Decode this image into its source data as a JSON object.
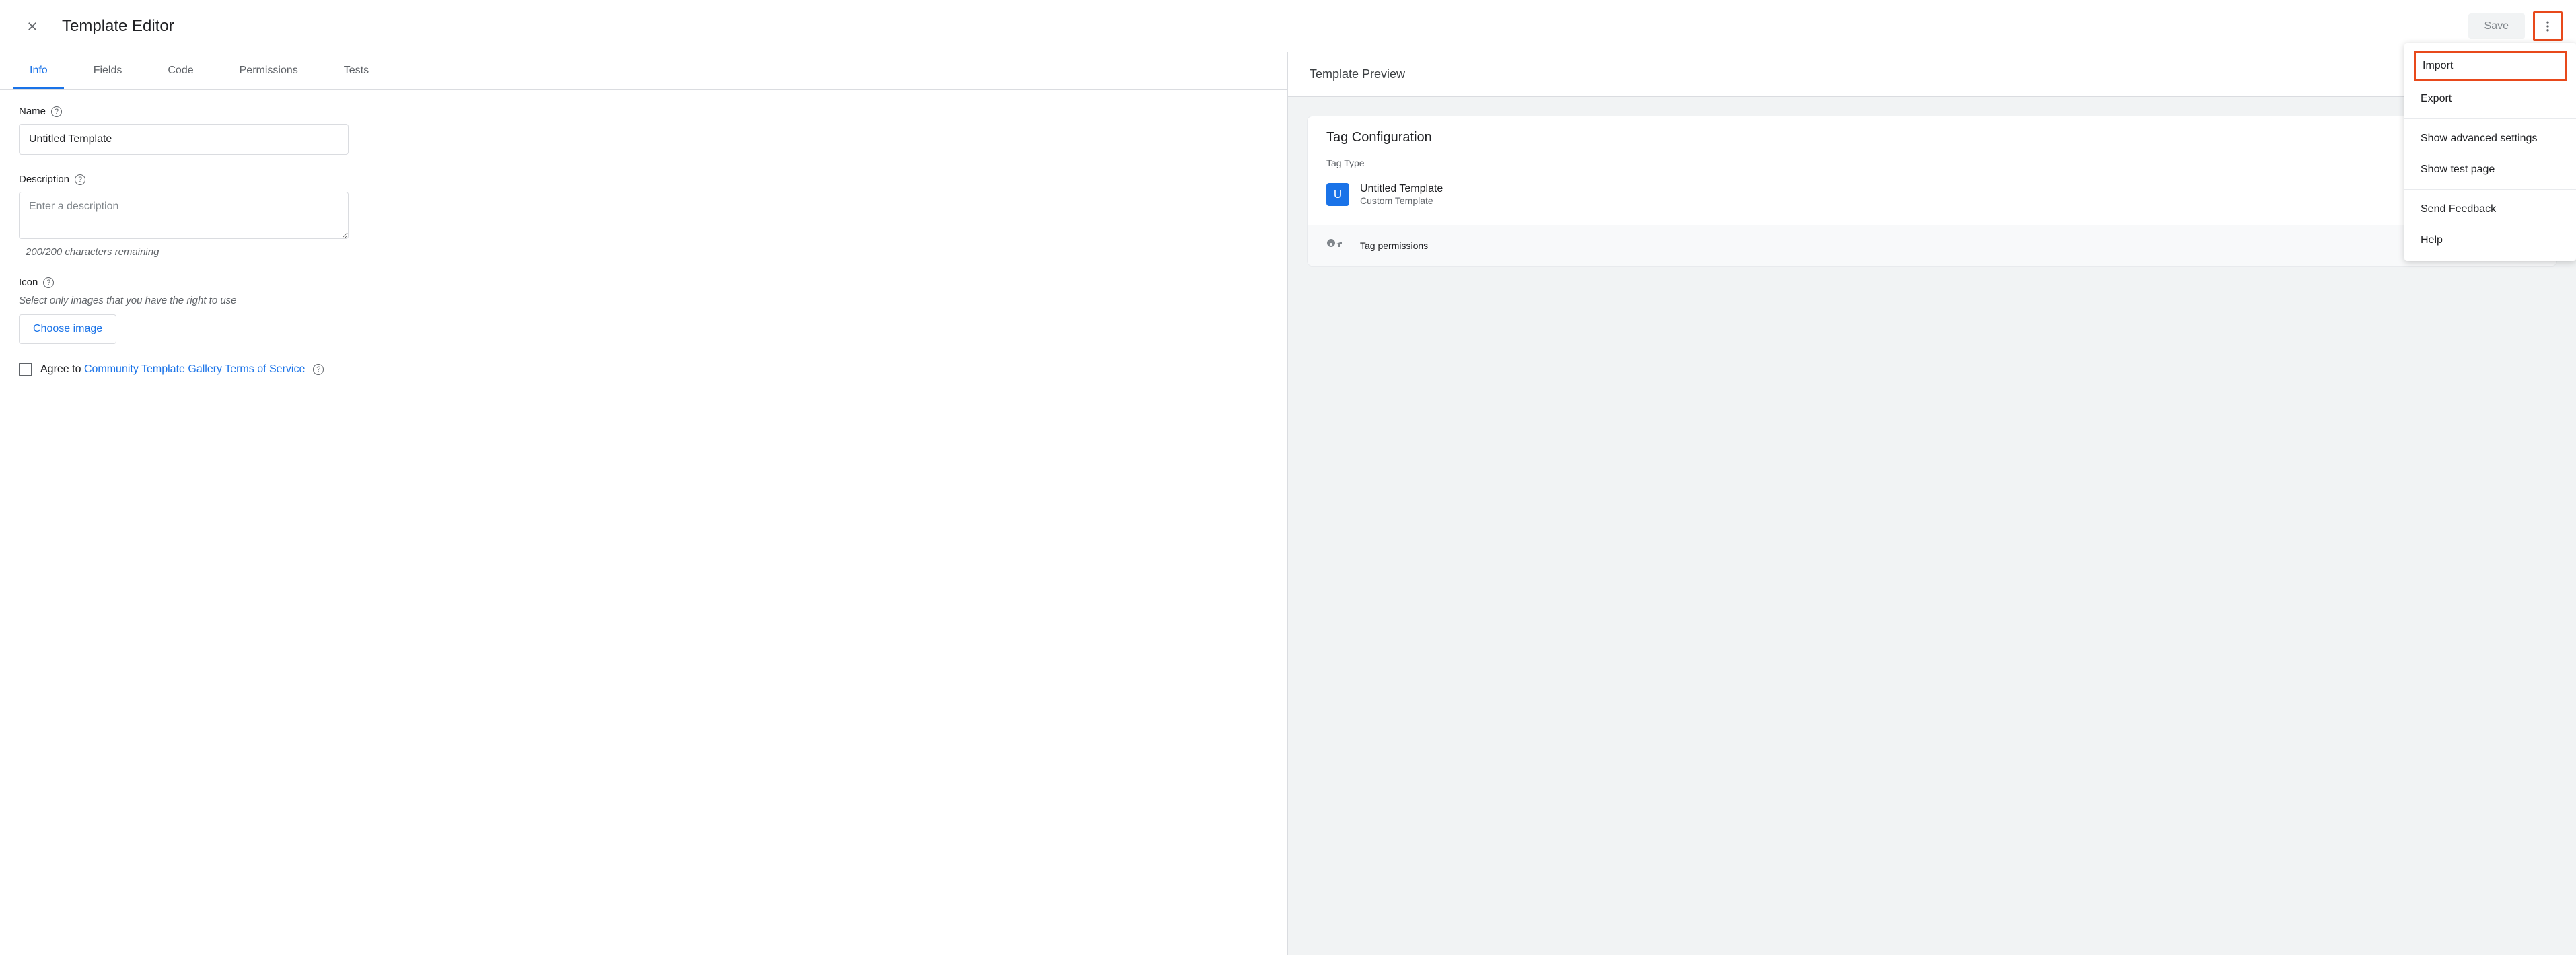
{
  "header": {
    "title": "Template Editor",
    "save": "Save"
  },
  "tabs": [
    "Info",
    "Fields",
    "Code",
    "Permissions",
    "Tests"
  ],
  "form": {
    "name_label": "Name",
    "name_value": "Untitled Template",
    "desc_label": "Description",
    "desc_placeholder": "Enter a description",
    "desc_helper": "200/200 characters remaining",
    "icon_label": "Icon",
    "icon_helper": "Select only images that you have the right to use",
    "choose_image": "Choose image",
    "agree_prefix": "Agree to ",
    "agree_link": "Community Template Gallery Terms of Service"
  },
  "preview": {
    "title": "Template Preview",
    "card_title": "Tag Configuration",
    "tag_type_label": "Tag Type",
    "template_badge": "U",
    "template_name": "Untitled Template",
    "template_sub": "Custom Template",
    "permissions": "Tag permissions"
  },
  "menu": {
    "import": "Import",
    "export": "Export",
    "advanced": "Show advanced settings",
    "test_page": "Show test page",
    "feedback": "Send Feedback",
    "help": "Help"
  }
}
